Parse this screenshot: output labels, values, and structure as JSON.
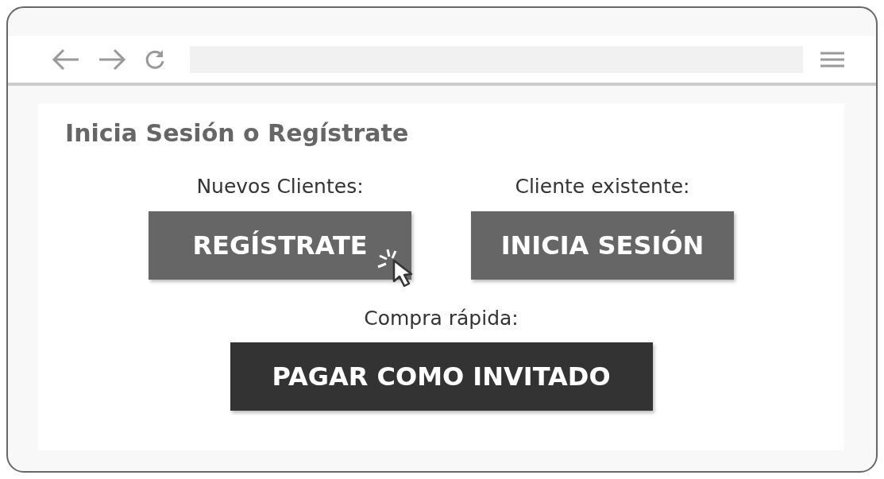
{
  "page": {
    "title": "Inicia Sesión o Regístrate",
    "groups": [
      {
        "items": [
          {
            "label": "Nuevos Clientes:",
            "button": "REGÍSTRATE",
            "kind": "secondary",
            "hovered": true
          },
          {
            "label": "Cliente existente:",
            "button": "INICIA SESIÓN",
            "kind": "secondary",
            "hovered": false
          }
        ]
      },
      {
        "items": [
          {
            "label": "Compra rápida:",
            "button": "PAGAR COMO INVITADO",
            "kind": "primary",
            "hovered": false
          }
        ]
      }
    ]
  }
}
